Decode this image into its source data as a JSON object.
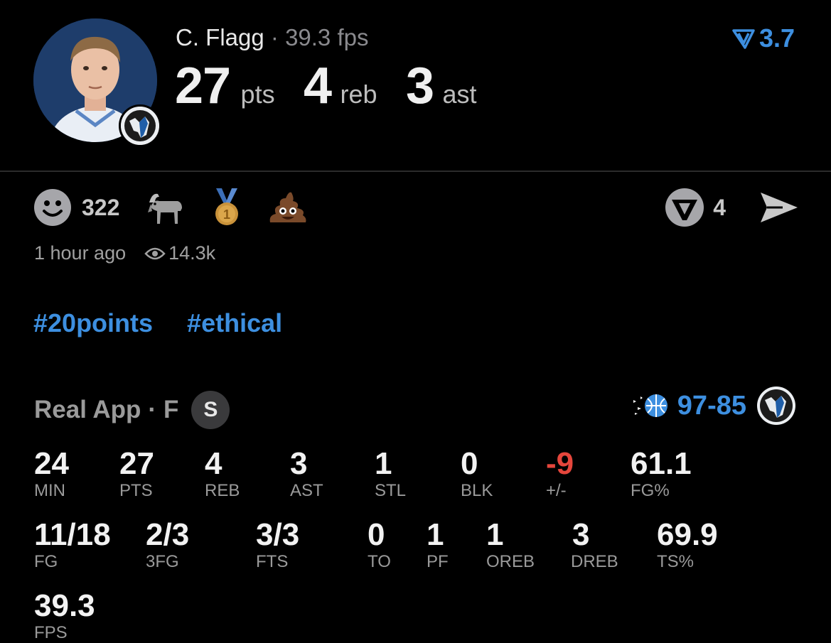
{
  "player": {
    "name": "C. Flagg",
    "separator": "·",
    "fps_text": "39.3 fps",
    "pts": "27",
    "pts_label": "pts",
    "reb": "4",
    "reb_label": "reb",
    "ast": "3",
    "ast_label": "ast"
  },
  "rating": {
    "value": "3.7",
    "icon": "voting-arrow-icon"
  },
  "reactions": {
    "count": "322",
    "items": [
      "goat-emoji",
      "gold-medal-emoji",
      "poop-emoji"
    ],
    "comments": "4"
  },
  "meta": {
    "time": "1 hour ago",
    "views": "14.3k"
  },
  "hashtags": [
    "#20points",
    "#ethical"
  ],
  "game": {
    "source": "Real App",
    "separator": "·",
    "status": "F",
    "badge": "S",
    "score_home": "97",
    "score_dash": "-",
    "score_away": "85"
  },
  "stats_row1": [
    {
      "value": "24",
      "label": "MIN"
    },
    {
      "value": "27",
      "label": "PTS"
    },
    {
      "value": "4",
      "label": "REB"
    },
    {
      "value": "3",
      "label": "AST"
    },
    {
      "value": "1",
      "label": "STL"
    },
    {
      "value": "0",
      "label": "BLK"
    },
    {
      "value": "-9",
      "label": "+/-"
    },
    {
      "value": "61.1",
      "label": "FG%"
    }
  ],
  "stats_row2": [
    {
      "value": "11/18",
      "label": "FG"
    },
    {
      "value": "2/3",
      "label": "3FG"
    },
    {
      "value": "3/3",
      "label": "FTS"
    },
    {
      "value": "0",
      "label": "TO"
    },
    {
      "value": "1",
      "label": "PF"
    },
    {
      "value": "1",
      "label": "OREB"
    },
    {
      "value": "3",
      "label": "DREB"
    },
    {
      "value": "69.9",
      "label": "TS%"
    }
  ],
  "stats_row3": [
    {
      "value": "39.3",
      "label": "FPS"
    }
  ],
  "colors": {
    "accent": "#3d8fe0",
    "negative": "#e5463c",
    "background": "#000000"
  }
}
